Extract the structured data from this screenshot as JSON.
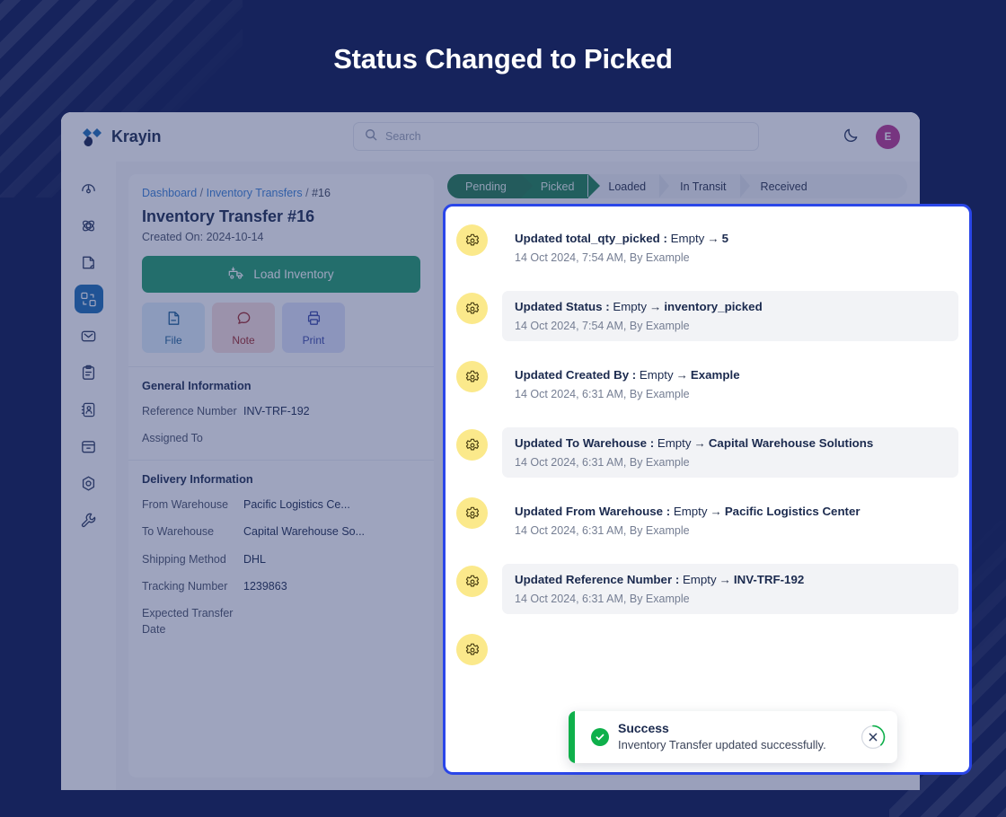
{
  "page": {
    "title": "Status Changed to Picked"
  },
  "topbar": {
    "brand": "Krayin",
    "search_placeholder": "Search",
    "add_label": "+",
    "avatar_initial": "E"
  },
  "sidebar": {
    "items": [
      {
        "name": "dashboard",
        "icon": "gauge-icon",
        "active": false
      },
      {
        "name": "leads",
        "icon": "atom-icon",
        "active": false
      },
      {
        "name": "quotes",
        "icon": "document-icon",
        "active": false
      },
      {
        "name": "transfers",
        "icon": "inventory-transfer-icon",
        "active": true
      },
      {
        "name": "mail",
        "icon": "envelope-icon",
        "active": false
      },
      {
        "name": "activities",
        "icon": "clipboard-icon",
        "active": false
      },
      {
        "name": "contacts",
        "icon": "contact-book-icon",
        "active": false
      },
      {
        "name": "products",
        "icon": "box-icon",
        "active": false
      },
      {
        "name": "settings",
        "icon": "hexagon-gear-icon",
        "active": false
      },
      {
        "name": "configure",
        "icon": "wrench-icon",
        "active": false
      }
    ]
  },
  "detail": {
    "breadcrumb": {
      "first": "Dashboard",
      "second": "Inventory Transfers",
      "current": "#16",
      "separator": "/"
    },
    "title": "Inventory Transfer #16",
    "created_on": "Created On: 2024-10-14",
    "load_button": "Load Inventory",
    "quick_buttons": [
      {
        "label": "File",
        "icon": "file-icon"
      },
      {
        "label": "Note",
        "icon": "note-icon"
      },
      {
        "label": "Print",
        "icon": "print-icon"
      }
    ],
    "general": {
      "heading": "General Information",
      "rows": [
        {
          "label": "Reference Number",
          "value": "INV-TRF-192"
        },
        {
          "label": "Assigned To",
          "value": ""
        }
      ]
    },
    "delivery": {
      "heading": "Delivery Information",
      "rows": [
        {
          "label": "From Warehouse",
          "value": "Pacific Logistics Ce..."
        },
        {
          "label": "To Warehouse",
          "value": "Capital Warehouse So..."
        },
        {
          "label": "Shipping Method",
          "value": "DHL"
        },
        {
          "label": "Tracking Number",
          "value": "1239863"
        },
        {
          "label": "Expected Transfer Date",
          "value": ""
        }
      ]
    }
  },
  "stepper": {
    "steps": [
      {
        "label": "Pending",
        "state": "done"
      },
      {
        "label": "Picked",
        "state": "current"
      },
      {
        "label": "Loaded",
        "state": "pending"
      },
      {
        "label": "In Transit",
        "state": "pending"
      },
      {
        "label": "Received",
        "state": "pending"
      }
    ]
  },
  "modal": {
    "activities": [
      {
        "field": "Updated total_qty_picked : ",
        "from": "Empty",
        "to": "5",
        "meta": "14 Oct 2024, 7:54 AM, By Example",
        "shaded": false
      },
      {
        "field": "Updated Status : ",
        "from": "Empty",
        "to": "inventory_picked",
        "meta": "14 Oct 2024, 7:54 AM, By Example",
        "shaded": true
      },
      {
        "field": "Updated Created By : ",
        "from": "Empty",
        "to": "Example",
        "meta": "14 Oct 2024, 6:31 AM, By Example",
        "shaded": false
      },
      {
        "field": "Updated To Warehouse : ",
        "from": "Empty",
        "to": "Capital Warehouse Solutions",
        "meta": "14 Oct 2024, 6:31 AM, By Example",
        "shaded": true
      },
      {
        "field": "Updated From Warehouse : ",
        "from": "Empty",
        "to": "Pacific Logistics Center",
        "meta": "14 Oct 2024, 6:31 AM, By Example",
        "shaded": false
      },
      {
        "field": "Updated Reference Number : ",
        "from": "Empty",
        "to": "INV-TRF-192",
        "meta": "14 Oct 2024, 6:31 AM, By Example",
        "shaded": true
      },
      {
        "field": "",
        "from": "",
        "to": "",
        "meta": "",
        "shaded": false
      }
    ],
    "arrow": "→"
  },
  "toast": {
    "title": "Success",
    "message": "Inventory Transfer updated successfully.",
    "close_label": "×"
  },
  "colors": {
    "page_bg": "#16235c",
    "accent_blue": "#2a46e8",
    "brand_blue": "#1a6cb5",
    "success_green": "#0fb04b",
    "step_green": "#1f7a4d",
    "gear_bubble": "#fbe98b",
    "avatar_pink": "#b9368e"
  }
}
